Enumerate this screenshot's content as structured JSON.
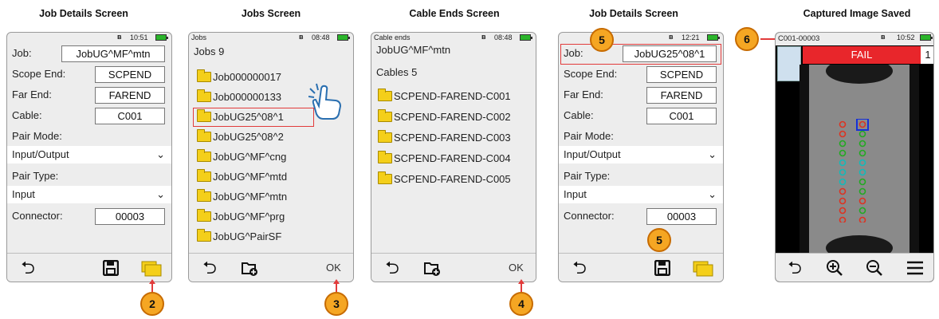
{
  "captions": [
    "Job Details Screen",
    "Jobs Screen",
    "Cable Ends Screen",
    "Job Details Screen",
    "Captured Image Saved"
  ],
  "screen1": {
    "time": "10:51",
    "fields": [
      {
        "label": "Job:",
        "value": "JobUG^MF^mtn"
      },
      {
        "label": "Scope End:",
        "value": "SCPEND"
      },
      {
        "label": "Far End:",
        "value": "FAREND"
      },
      {
        "label": "Cable:",
        "value": "C001"
      }
    ],
    "pair_mode_label": "Pair Mode:",
    "pair_mode_value": "Input/Output",
    "pair_type_label": "Pair Type:",
    "pair_type_value": "Input",
    "connector_label": "Connector:",
    "connector_value": "00003",
    "badge": "2"
  },
  "screen2": {
    "header": "Jobs",
    "time": "08:48",
    "title": "Jobs 9",
    "items": [
      "Job000000017",
      "Job000000133",
      "JobUG25^08^1",
      "JobUG25^08^2",
      "JobUG^MF^cng",
      "JobUG^MF^mtd",
      "JobUG^MF^mtn",
      "JobUG^MF^prg",
      "JobUG^PairSF"
    ],
    "ok": "OK",
    "badge": "3"
  },
  "screen3": {
    "header": "Cable ends",
    "time": "08:48",
    "job": "JobUG^MF^mtn",
    "title": "Cables 5",
    "items": [
      "SCPEND-FAREND-C001",
      "SCPEND-FAREND-C002",
      "SCPEND-FAREND-C003",
      "SCPEND-FAREND-C004",
      "SCPEND-FAREND-C005"
    ],
    "ok": "OK",
    "badge": "4"
  },
  "screen4": {
    "time": "12:21",
    "fields": [
      {
        "label": "Job:",
        "value": "JobUG25^08^1"
      },
      {
        "label": "Scope End:",
        "value": "SCPEND"
      },
      {
        "label": "Far End:",
        "value": "FAREND"
      },
      {
        "label": "Cable:",
        "value": "C001"
      }
    ],
    "pair_mode_label": "Pair Mode:",
    "pair_mode_value": "Input/Output",
    "pair_type_label": "Pair Type:",
    "pair_type_value": "Input",
    "connector_label": "Connector:",
    "connector_value": "00003",
    "badge_top": "5",
    "badge_bottom": "5"
  },
  "screen5": {
    "id": "C001-00003",
    "time": "10:52",
    "status": "FAIL",
    "page": "1",
    "badge": "6",
    "status_color": "#e8262b"
  }
}
